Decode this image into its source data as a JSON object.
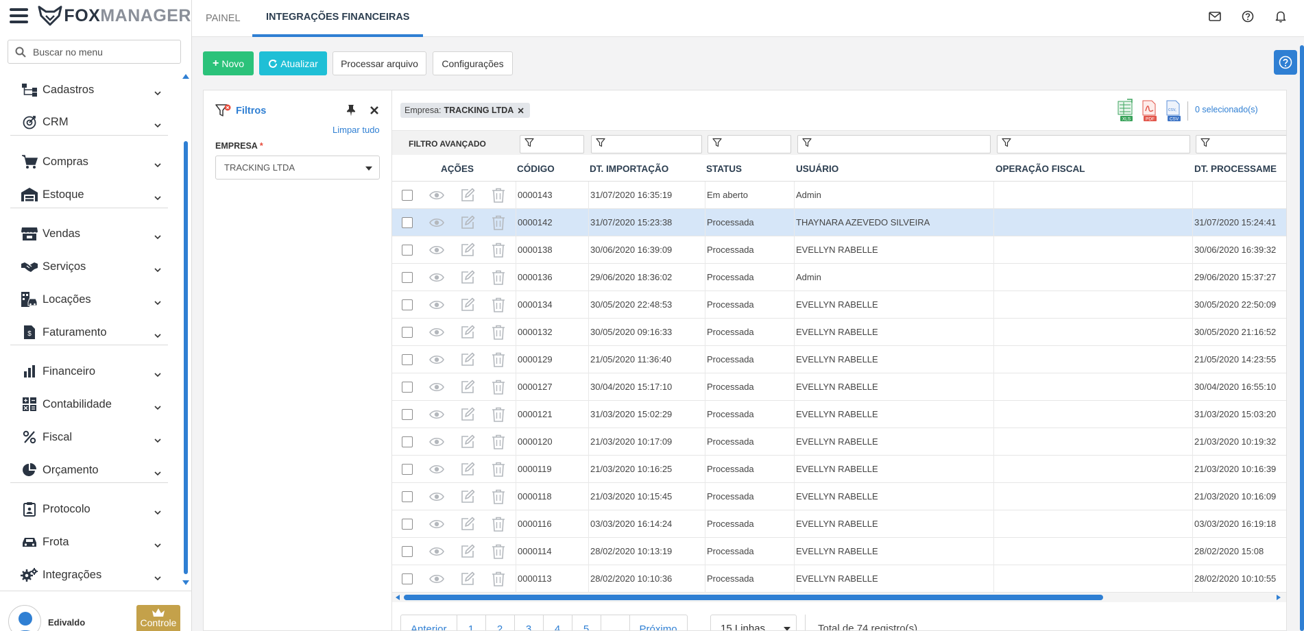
{
  "app": {
    "logo_left": "FOX",
    "logo_right": "MANAGER"
  },
  "sidebar": {
    "search_placeholder": "Buscar no menu",
    "items": [
      {
        "label": "Cadastros",
        "icon": "hierarchy-icon"
      },
      {
        "label": "CRM",
        "icon": "target-icon"
      },
      {
        "label": "Compras",
        "icon": "cart-icon"
      },
      {
        "label": "Estoque",
        "icon": "warehouse-icon"
      },
      {
        "label": "Vendas",
        "icon": "store-icon"
      },
      {
        "label": "Serviços",
        "icon": "handshake-icon"
      },
      {
        "label": "Locações",
        "icon": "building-car-icon"
      },
      {
        "label": "Faturamento",
        "icon": "invoice-icon"
      },
      {
        "label": "Financeiro",
        "icon": "bar-chart-icon"
      },
      {
        "label": "Contabilidade",
        "icon": "calculator-icon"
      },
      {
        "label": "Fiscal",
        "icon": "percent-icon"
      },
      {
        "label": "Orçamento",
        "icon": "pie-chart-icon"
      },
      {
        "label": "Protocolo",
        "icon": "clipboard-icon"
      },
      {
        "label": "Frota",
        "icon": "car-icon"
      },
      {
        "label": "Integrações",
        "icon": "gears-icon"
      }
    ],
    "user": {
      "name": "Edivaldo",
      "control_label": "Controle"
    }
  },
  "tabs": [
    {
      "label": "PAINEL",
      "active": false
    },
    {
      "label": "INTEGRAÇÕES FINANCEIRAS",
      "active": true
    }
  ],
  "toolbar": {
    "new_label": "Novo",
    "refresh_label": "Atualizar",
    "process_label": "Processar arquivo",
    "settings_label": "Configurações"
  },
  "filters": {
    "title": "Filtros",
    "clear_label": "Limpar tudo",
    "company_label": "EMPRESA",
    "required_mark": "*",
    "company_value": "TRACKING LTDA"
  },
  "grid": {
    "chip_label": "Empresa:",
    "chip_value": "TRACKING LTDA",
    "chip_remove": "✕",
    "selected_text": "0 selecionado(s)",
    "export": {
      "xls": "XLS",
      "pdf": "PDF",
      "csv": "CSV"
    },
    "advanced_filter_label": "FILTRO AVANÇADO",
    "columns": [
      "AÇÕES",
      "CÓDIGO",
      "DT. IMPORTAÇÃO",
      "STATUS",
      "USUÁRIO",
      "OPERAÇÃO FISCAL",
      "DT. PROCESSAME"
    ],
    "rows": [
      {
        "codigo": "0000143",
        "dt_importacao": "31/07/2020 16:35:19",
        "status": "Em aberto",
        "usuario": "Admin",
        "operacao_fiscal": "",
        "dt_processamento": "",
        "selected": false
      },
      {
        "codigo": "0000142",
        "dt_importacao": "31/07/2020 15:23:38",
        "status": "Processada",
        "usuario": "THAYNARA AZEVEDO SILVEIRA",
        "operacao_fiscal": "",
        "dt_processamento": "31/07/2020 15:24:41",
        "selected": true
      },
      {
        "codigo": "0000138",
        "dt_importacao": "30/06/2020 16:39:09",
        "status": "Processada",
        "usuario": "EVELLYN RABELLE",
        "operacao_fiscal": "",
        "dt_processamento": "30/06/2020 16:39:32",
        "selected": false
      },
      {
        "codigo": "0000136",
        "dt_importacao": "29/06/2020 18:36:02",
        "status": "Processada",
        "usuario": "Admin",
        "operacao_fiscal": "",
        "dt_processamento": "29/06/2020 15:37:27",
        "selected": false
      },
      {
        "codigo": "0000134",
        "dt_importacao": "30/05/2020 22:48:53",
        "status": "Processada",
        "usuario": "EVELLYN RABELLE",
        "operacao_fiscal": "",
        "dt_processamento": "30/05/2020 22:50:09",
        "selected": false
      },
      {
        "codigo": "0000132",
        "dt_importacao": "30/05/2020 09:16:33",
        "status": "Processada",
        "usuario": "EVELLYN RABELLE",
        "operacao_fiscal": "",
        "dt_processamento": "30/05/2020 21:16:52",
        "selected": false
      },
      {
        "codigo": "0000129",
        "dt_importacao": "21/05/2020 11:36:40",
        "status": "Processada",
        "usuario": "EVELLYN RABELLE",
        "operacao_fiscal": "",
        "dt_processamento": "21/05/2020 14:23:55",
        "selected": false
      },
      {
        "codigo": "0000127",
        "dt_importacao": "30/04/2020 15:17:10",
        "status": "Processada",
        "usuario": "EVELLYN RABELLE",
        "operacao_fiscal": "",
        "dt_processamento": "30/04/2020 16:55:10",
        "selected": false
      },
      {
        "codigo": "0000121",
        "dt_importacao": "31/03/2020 15:02:29",
        "status": "Processada",
        "usuario": "EVELLYN RABELLE",
        "operacao_fiscal": "",
        "dt_processamento": "31/03/2020 15:03:20",
        "selected": false
      },
      {
        "codigo": "0000120",
        "dt_importacao": "21/03/2020 10:17:09",
        "status": "Processada",
        "usuario": "EVELLYN RABELLE",
        "operacao_fiscal": "",
        "dt_processamento": "21/03/2020 10:19:32",
        "selected": false
      },
      {
        "codigo": "0000119",
        "dt_importacao": "21/03/2020 10:16:25",
        "status": "Processada",
        "usuario": "EVELLYN RABELLE",
        "operacao_fiscal": "",
        "dt_processamento": "21/03/2020 10:16:39",
        "selected": false
      },
      {
        "codigo": "0000118",
        "dt_importacao": "21/03/2020 10:15:45",
        "status": "Processada",
        "usuario": "EVELLYN RABELLE",
        "operacao_fiscal": "",
        "dt_processamento": "21/03/2020 10:16:09",
        "selected": false
      },
      {
        "codigo": "0000116",
        "dt_importacao": "03/03/2020 16:14:24",
        "status": "Processada",
        "usuario": "EVELLYN RABELLE",
        "operacao_fiscal": "",
        "dt_processamento": "03/03/2020 16:19:18",
        "selected": false
      },
      {
        "codigo": "0000114",
        "dt_importacao": "28/02/2020 10:13:19",
        "status": "Processada",
        "usuario": "EVELLYN RABELLE",
        "operacao_fiscal": "",
        "dt_processamento": "28/02/2020 15:08",
        "selected": false
      },
      {
        "codigo": "0000113",
        "dt_importacao": "28/02/2020 10:10:36",
        "status": "Processada",
        "usuario": "EVELLYN RABELLE",
        "operacao_fiscal": "",
        "dt_processamento": "28/02/2020 10:10:55",
        "selected": false
      }
    ]
  },
  "pagination": {
    "prev_label": "Anterior",
    "pages": [
      "1",
      "2",
      "3",
      "4",
      "5",
      ""
    ],
    "next_label": "Próximo",
    "rows_per_page": "15 Linhas",
    "total_text": "Total de 74 registro(s)"
  },
  "colors": {
    "accent": "#2f7fd3",
    "new": "#2bc27a",
    "refresh": "#1fbfd6",
    "selected_row": "#d6e6f8",
    "control": "#c4a14a"
  }
}
